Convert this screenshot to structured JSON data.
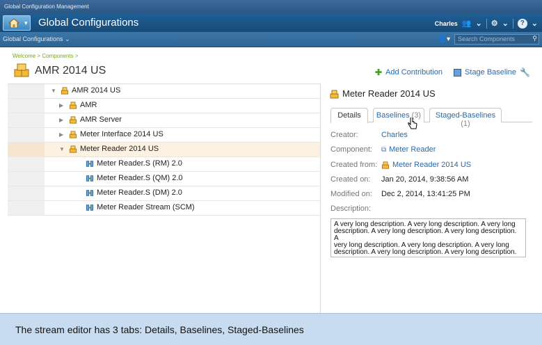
{
  "app": {
    "window_title": "Global Configuration Management",
    "header_title": "Global Configurations",
    "user_name": "Charles",
    "subbar_label": "Global Configurations",
    "search_placeholder": "Search Components"
  },
  "breadcrumb": "Welcome > Components >",
  "page_title": "AMR 2014 US",
  "actions": {
    "add_contribution": "Add Contribution",
    "stage_baseline": "Stage Baseline"
  },
  "tree": [
    {
      "label": "AMR 2014 US",
      "icon": "package-icon",
      "twisty": "expanded",
      "indent": 0
    },
    {
      "label": "AMR",
      "icon": "package-icon",
      "twisty": "collapsed",
      "indent": 1
    },
    {
      "label": "AMR Server",
      "icon": "package-icon",
      "twisty": "collapsed",
      "indent": 1
    },
    {
      "label": "Meter Interface 2014 US",
      "icon": "package-icon",
      "twisty": "collapsed",
      "indent": 1
    },
    {
      "label": "Meter Reader 2014 US",
      "icon": "package-icon",
      "twisty": "expanded",
      "indent": 1,
      "selected": true
    },
    {
      "label": "Meter Reader.S (RM) 2.0",
      "icon": "stream-icon",
      "twisty": "none",
      "indent": 2
    },
    {
      "label": "Meter Reader.S (QM) 2.0",
      "icon": "stream-icon",
      "twisty": "none",
      "indent": 2
    },
    {
      "label": "Meter Reader.S (DM) 2.0",
      "icon": "stream-icon",
      "twisty": "none",
      "indent": 2
    },
    {
      "label": "Meter Reader Stream (SCM)",
      "icon": "stream-icon",
      "twisty": "none",
      "indent": 2
    }
  ],
  "details": {
    "title": "Meter Reader 2014 US",
    "tabs": [
      {
        "label": "Details",
        "count": ""
      },
      {
        "label": "Baselines",
        "count": "(3)"
      },
      {
        "label": "Staged-Baselines",
        "count": "(1)"
      }
    ],
    "active_tab": "Details",
    "labels": {
      "creator": "Creator:",
      "component": "Component:",
      "created_from": "Created from:",
      "created_on": "Created on:",
      "modified_on": "Modified on:",
      "description": "Description:"
    },
    "values": {
      "creator": "Charles",
      "component": "Meter Reader",
      "created_from": "Meter Reader 2014 US",
      "created_on": "Jan 20, 2014, 9:38:56 AM",
      "modified_on": "Dec 2, 2014, 13:41:25 PM"
    },
    "description_lines": [
      "A very long description. A very long description. A very long",
      "description. A very long description. A very long description. A",
      "very long description. A very long description. A very long",
      "description. A very long description. A very long description."
    ]
  },
  "caption": "The stream editor has 3 tabs: Details, Baselines, Staged-Baselines",
  "colors": {
    "header_blue": "#1f5f95",
    "link_blue": "#2a6aa8",
    "selected_row": "#fdf1e2",
    "package_orange": "#f0a020",
    "caption_bg": "#c7dcf0"
  }
}
